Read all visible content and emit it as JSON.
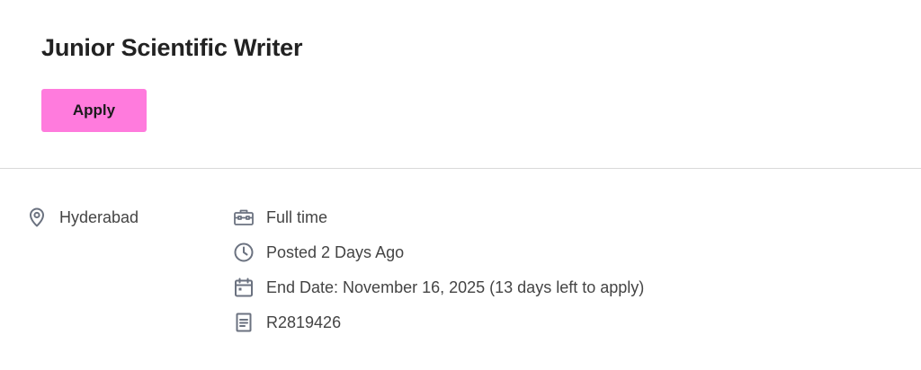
{
  "job": {
    "title": "Junior Scientific Writer",
    "apply_label": "Apply",
    "location": "Hyderabad",
    "time_type": "Full time",
    "posted": "Posted 2 Days Ago",
    "end_date": "End Date: November 16, 2025 (13 days left to apply)",
    "requisition_id": "R2819426"
  },
  "icons": {
    "location": "map-pin-icon",
    "time_type": "briefcase-icon",
    "posted": "clock-icon",
    "end_date": "calendar-icon",
    "requisition_id": "document-icon"
  },
  "colors": {
    "apply_button": "#ff7bdd",
    "icon": "#6b7280",
    "text": "#444444",
    "divider": "#d9d9d9"
  }
}
